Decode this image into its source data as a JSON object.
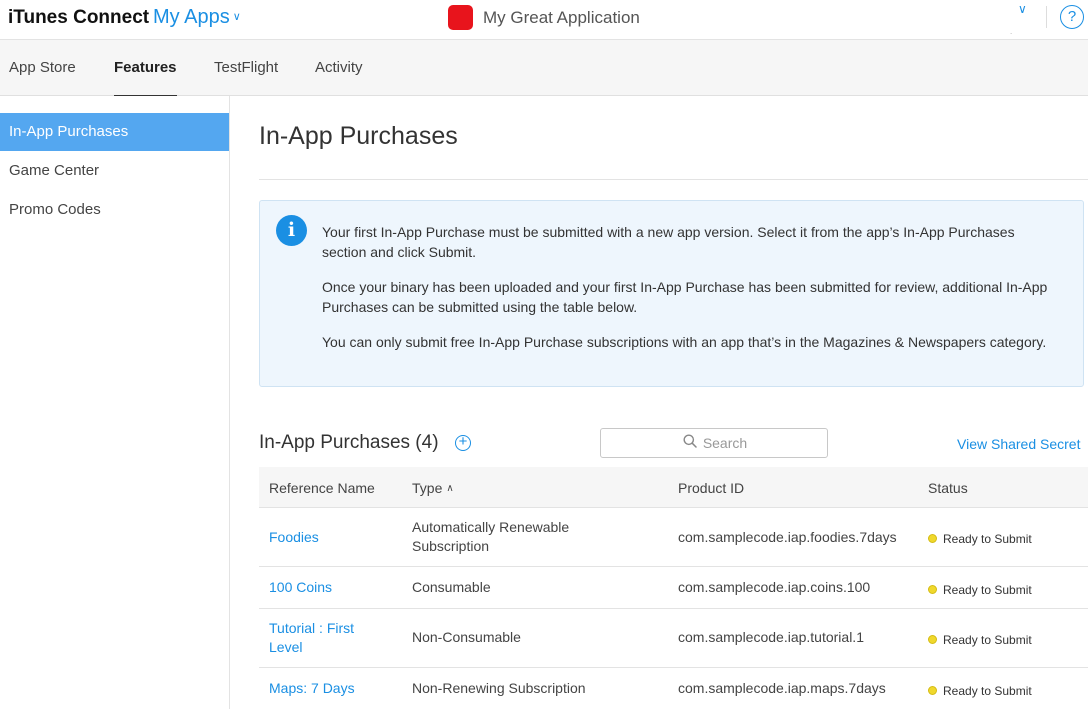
{
  "header": {
    "brand": "iTunes Connect",
    "my_apps": "My Apps",
    "app_name": "My Great Application",
    "help": "?",
    "colors": {
      "accent": "#1a8fe3",
      "app_icon": "#e8141c"
    }
  },
  "tabs": [
    {
      "label": "App Store"
    },
    {
      "label": "Features",
      "active": true
    },
    {
      "label": "TestFlight"
    },
    {
      "label": "Activity"
    }
  ],
  "sidebar": {
    "items": [
      {
        "label": "In-App Purchases",
        "active": true
      },
      {
        "label": "Game Center"
      },
      {
        "label": "Promo Codes"
      }
    ]
  },
  "main": {
    "title": "In-App Purchases",
    "info": {
      "icon": "info-icon",
      "paragraphs": [
        "Your first In-App Purchase must be submitted with a new app version. Select it from the app’s In-App Purchases section and click Submit.",
        "Once your binary has been uploaded and your first In-App Purchase has been submitted for review, additional In-App Purchases can be submitted using the table below.",
        "You can only submit free In-App Purchase subscriptions with an app that’s in the Magazines & Newspapers category."
      ]
    },
    "list": {
      "title": "In-App Purchases (4)",
      "search_placeholder": "Search",
      "shared_secret": "View Shared Secret",
      "columns": [
        "Reference Name",
        "Type",
        "Product ID",
        "Status"
      ],
      "rows": [
        {
          "name": "Foodies",
          "type": "Automatically Renewable Subscription",
          "product_id": "com.samplecode.iap.foodies.7days",
          "status": "Ready to Submit"
        },
        {
          "name": "100 Coins",
          "type": "Consumable",
          "product_id": "com.samplecode.iap.coins.100",
          "status": "Ready to Submit"
        },
        {
          "name": "Tutorial : First Level",
          "type": "Non-Consumable",
          "product_id": "com.samplecode.iap.tutorial.1",
          "status": "Ready to Submit"
        },
        {
          "name": "Maps: 7 Days",
          "type": "Non-Renewing Subscription",
          "product_id": "com.samplecode.iap.maps.7days",
          "status": "Ready to Submit"
        }
      ]
    }
  }
}
